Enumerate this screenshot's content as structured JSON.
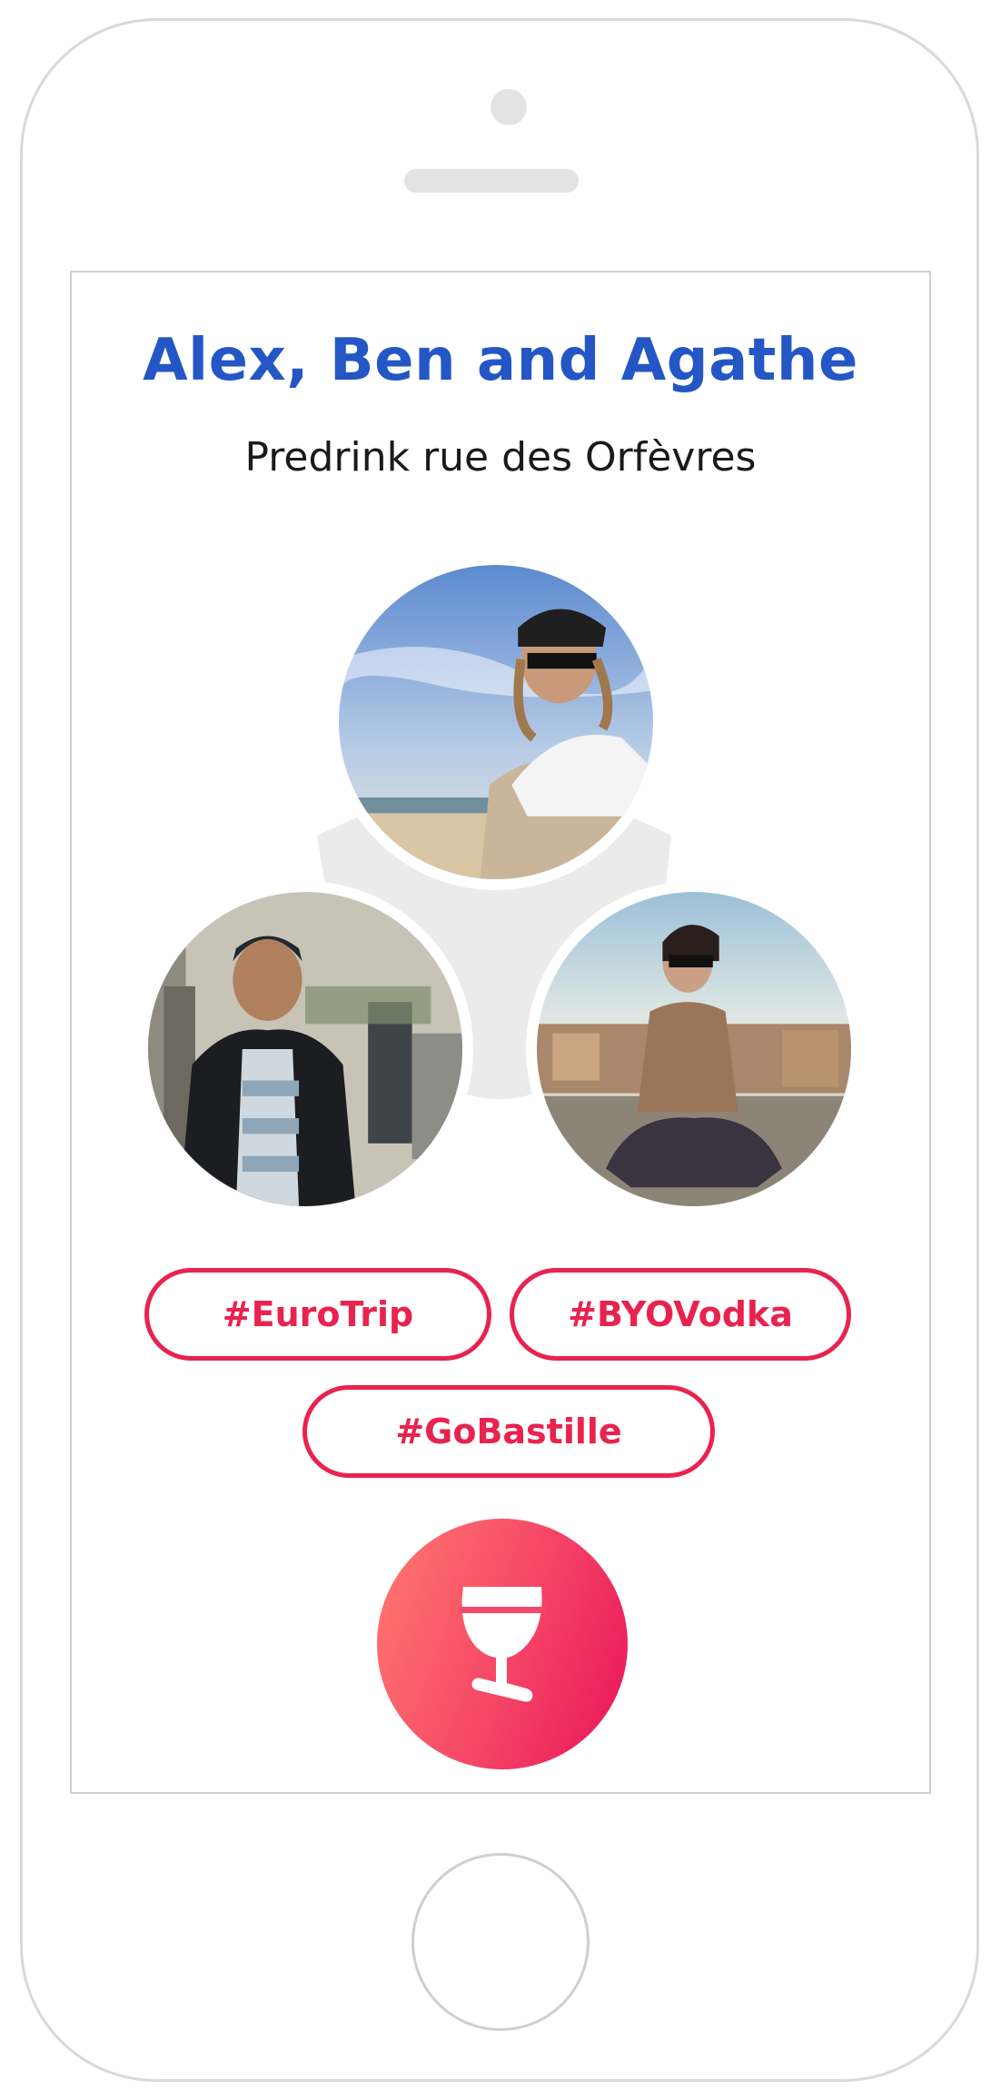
{
  "event": {
    "title": "Alex, Ben and Agathe",
    "subtitle": "Predrink rue des Orfèvres"
  },
  "avatars": [
    {
      "icon": "person-photo-beach"
    },
    {
      "icon": "person-photo-city"
    },
    {
      "icon": "person-photo-rooftop"
    }
  ],
  "tags": [
    "#EuroTrip",
    "#BYOVodka",
    "#GoBastille"
  ],
  "action": {
    "icon": "wine-glass-icon"
  },
  "colors": {
    "title": "#2457c5",
    "accent": "#e8234f",
    "gradient_start": "#ff7a6e",
    "gradient_end": "#e8145a"
  }
}
